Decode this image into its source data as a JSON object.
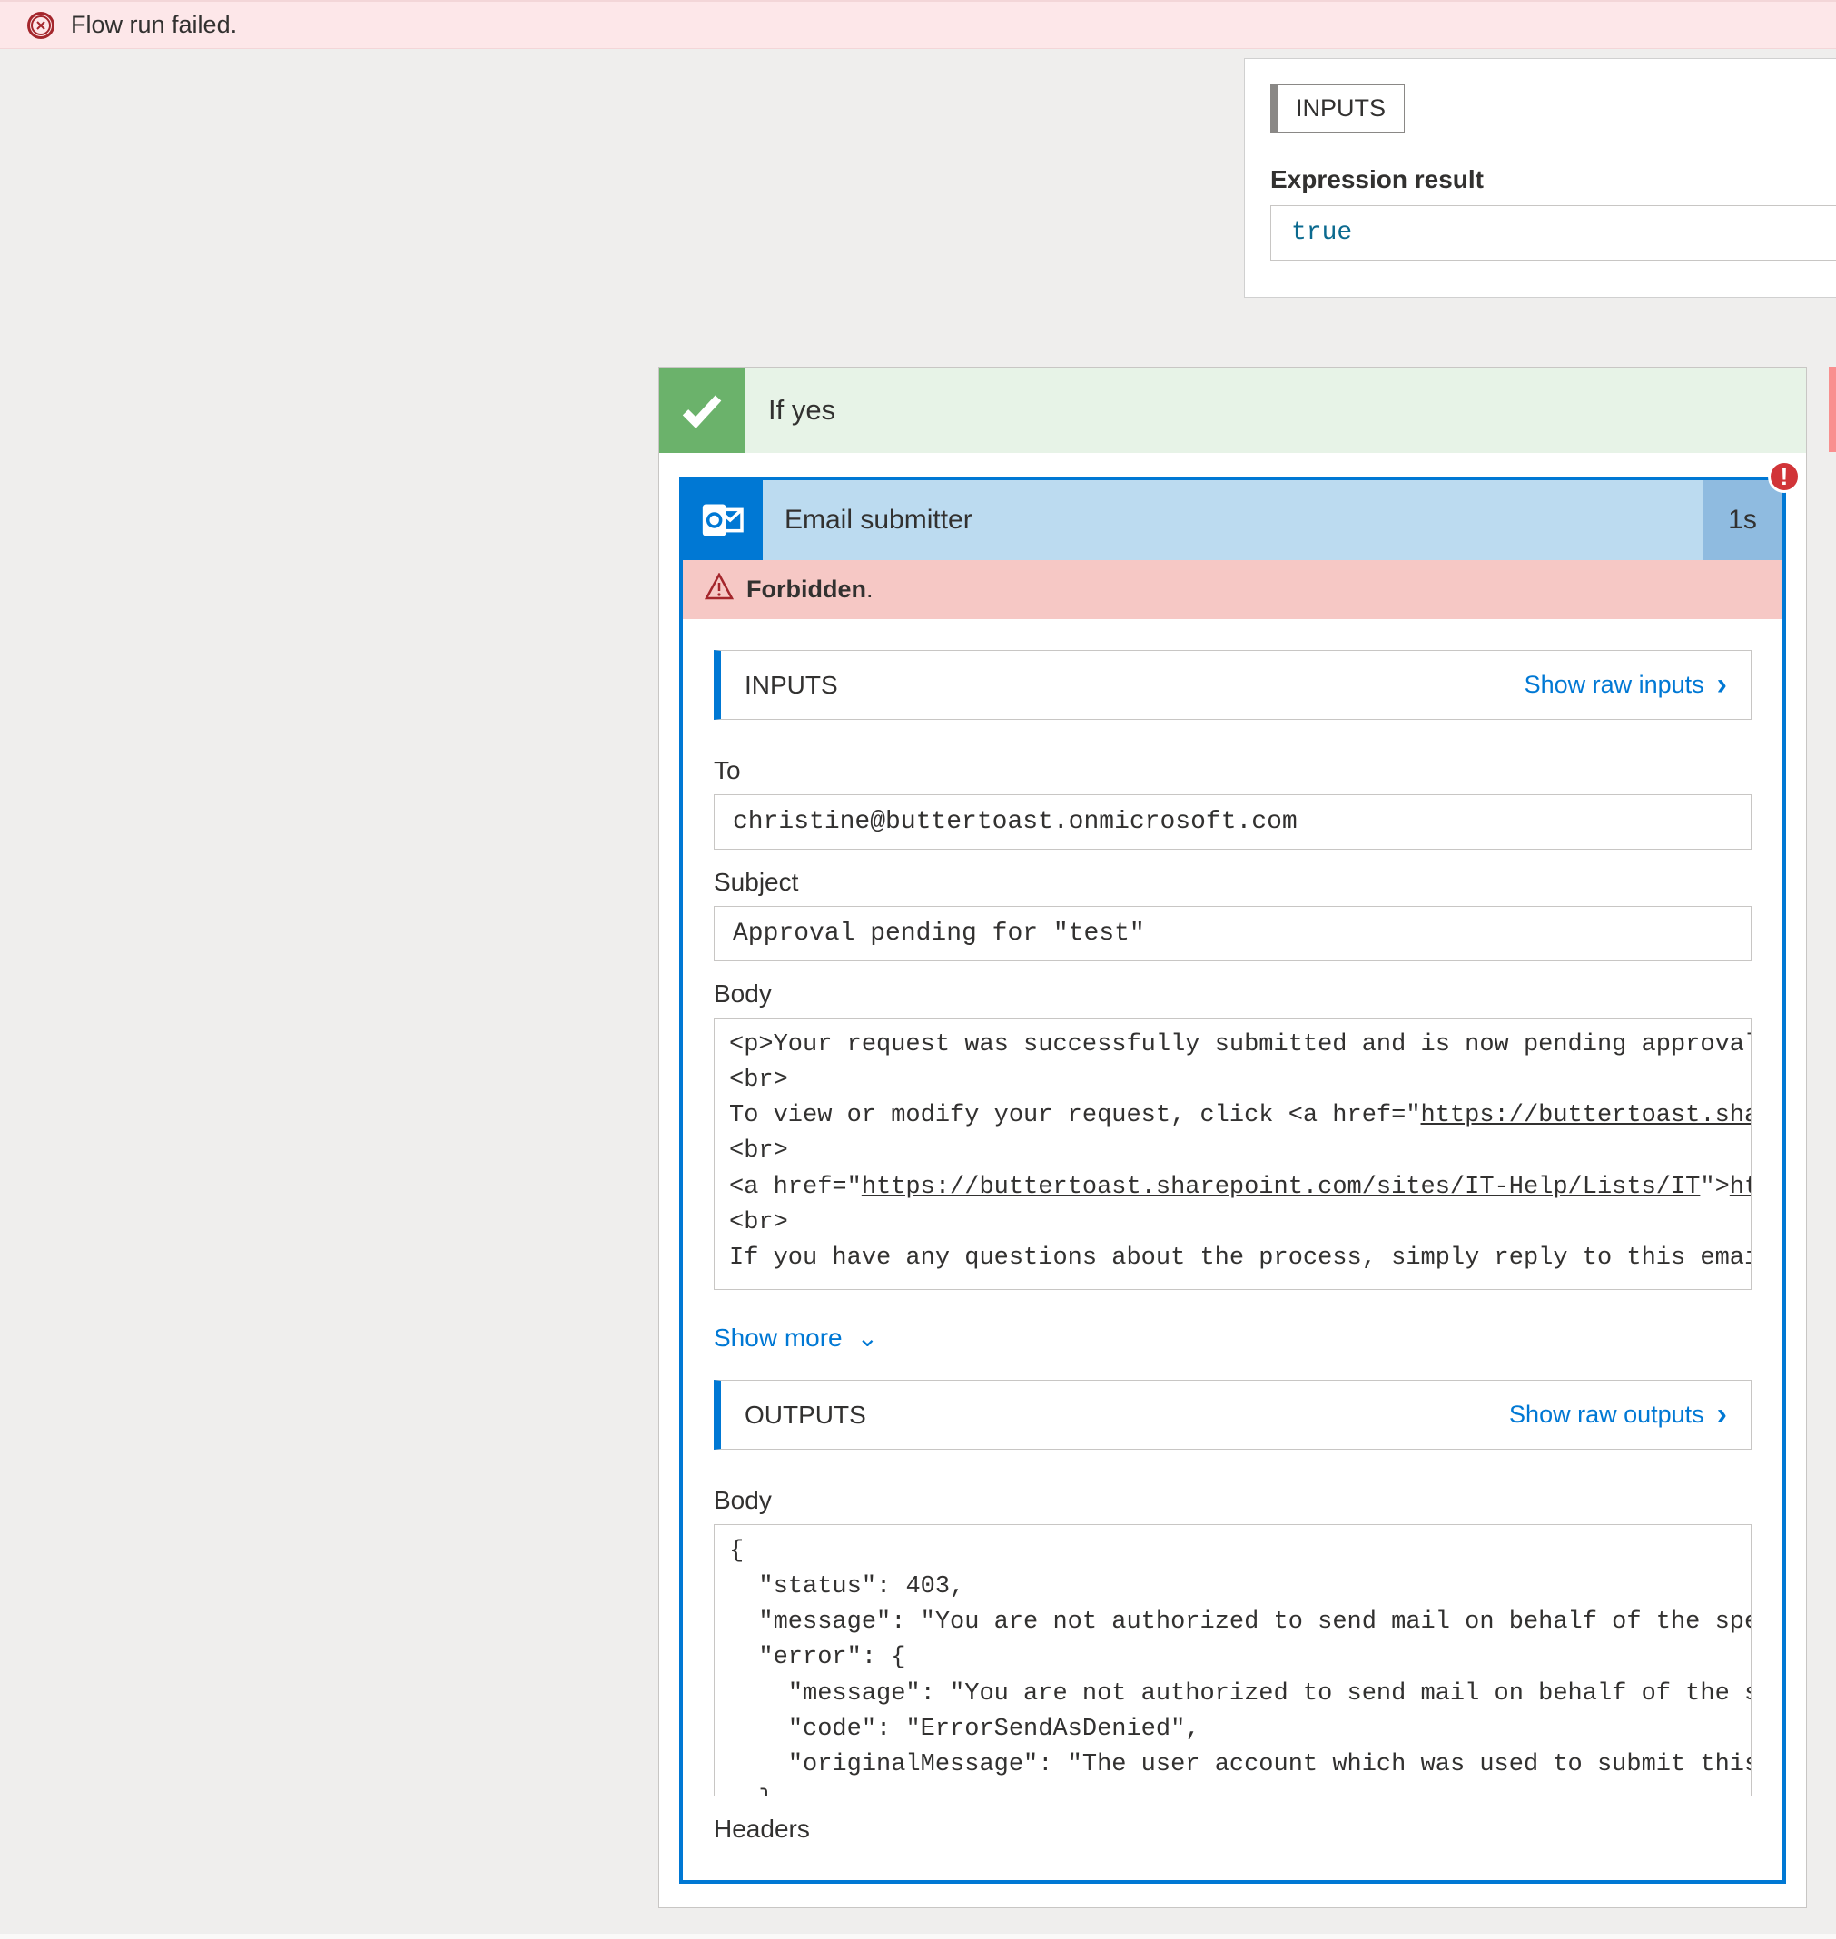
{
  "banner": {
    "text": "Flow run failed."
  },
  "expression": {
    "section_label": "INPUTS",
    "result_label": "Expression result",
    "result_value": "true"
  },
  "branch_yes": {
    "title": "If yes"
  },
  "action": {
    "title": "Email submitter",
    "duration": "1s",
    "error_label": "Forbidden",
    "error_suffix": ".",
    "inputs": {
      "section_label": "INPUTS",
      "show_raw": "Show raw inputs",
      "to_label": "To",
      "to_value": "christine@buttertoast.onmicrosoft.com",
      "subject_label": "Subject",
      "subject_value": "Approval pending for \"test\"",
      "body_label": "Body",
      "body_html": "<p>Your request was successfully submitted and is now pending approval.<br>\n<br>\nTo view or modify your request, click <a href=\"https://buttertoast.sharepoint.com\">https://buttertoast.</a><br>\n<br>\n<a href=\"https://buttertoast.sharepoint.com/sites/IT-Help/Lists/IT\">https://buttertoast.sharepoint.com/sites/IT-Help/Lists/IT%</a><br>\n<br>\nIf you have any questions about the process, simply reply to this email.",
      "show_more": "Show more"
    },
    "outputs": {
      "section_label": "OUTPUTS",
      "show_raw": "Show raw outputs",
      "body_label": "Body",
      "headers_label": "Headers",
      "body_json": {
        "status": 403,
        "message": "You are not authorized to send mail on behalf of the specified sending account.",
        "error": {
          "message": "You are not authorized to send mail on behalf of the specified sending account.",
          "code": "ErrorSendAsDenied",
          "originalMessage": "The user account which was used to submit this request does not have the right to send mail on behalf of the specified sending account."
        }
      }
    }
  }
}
